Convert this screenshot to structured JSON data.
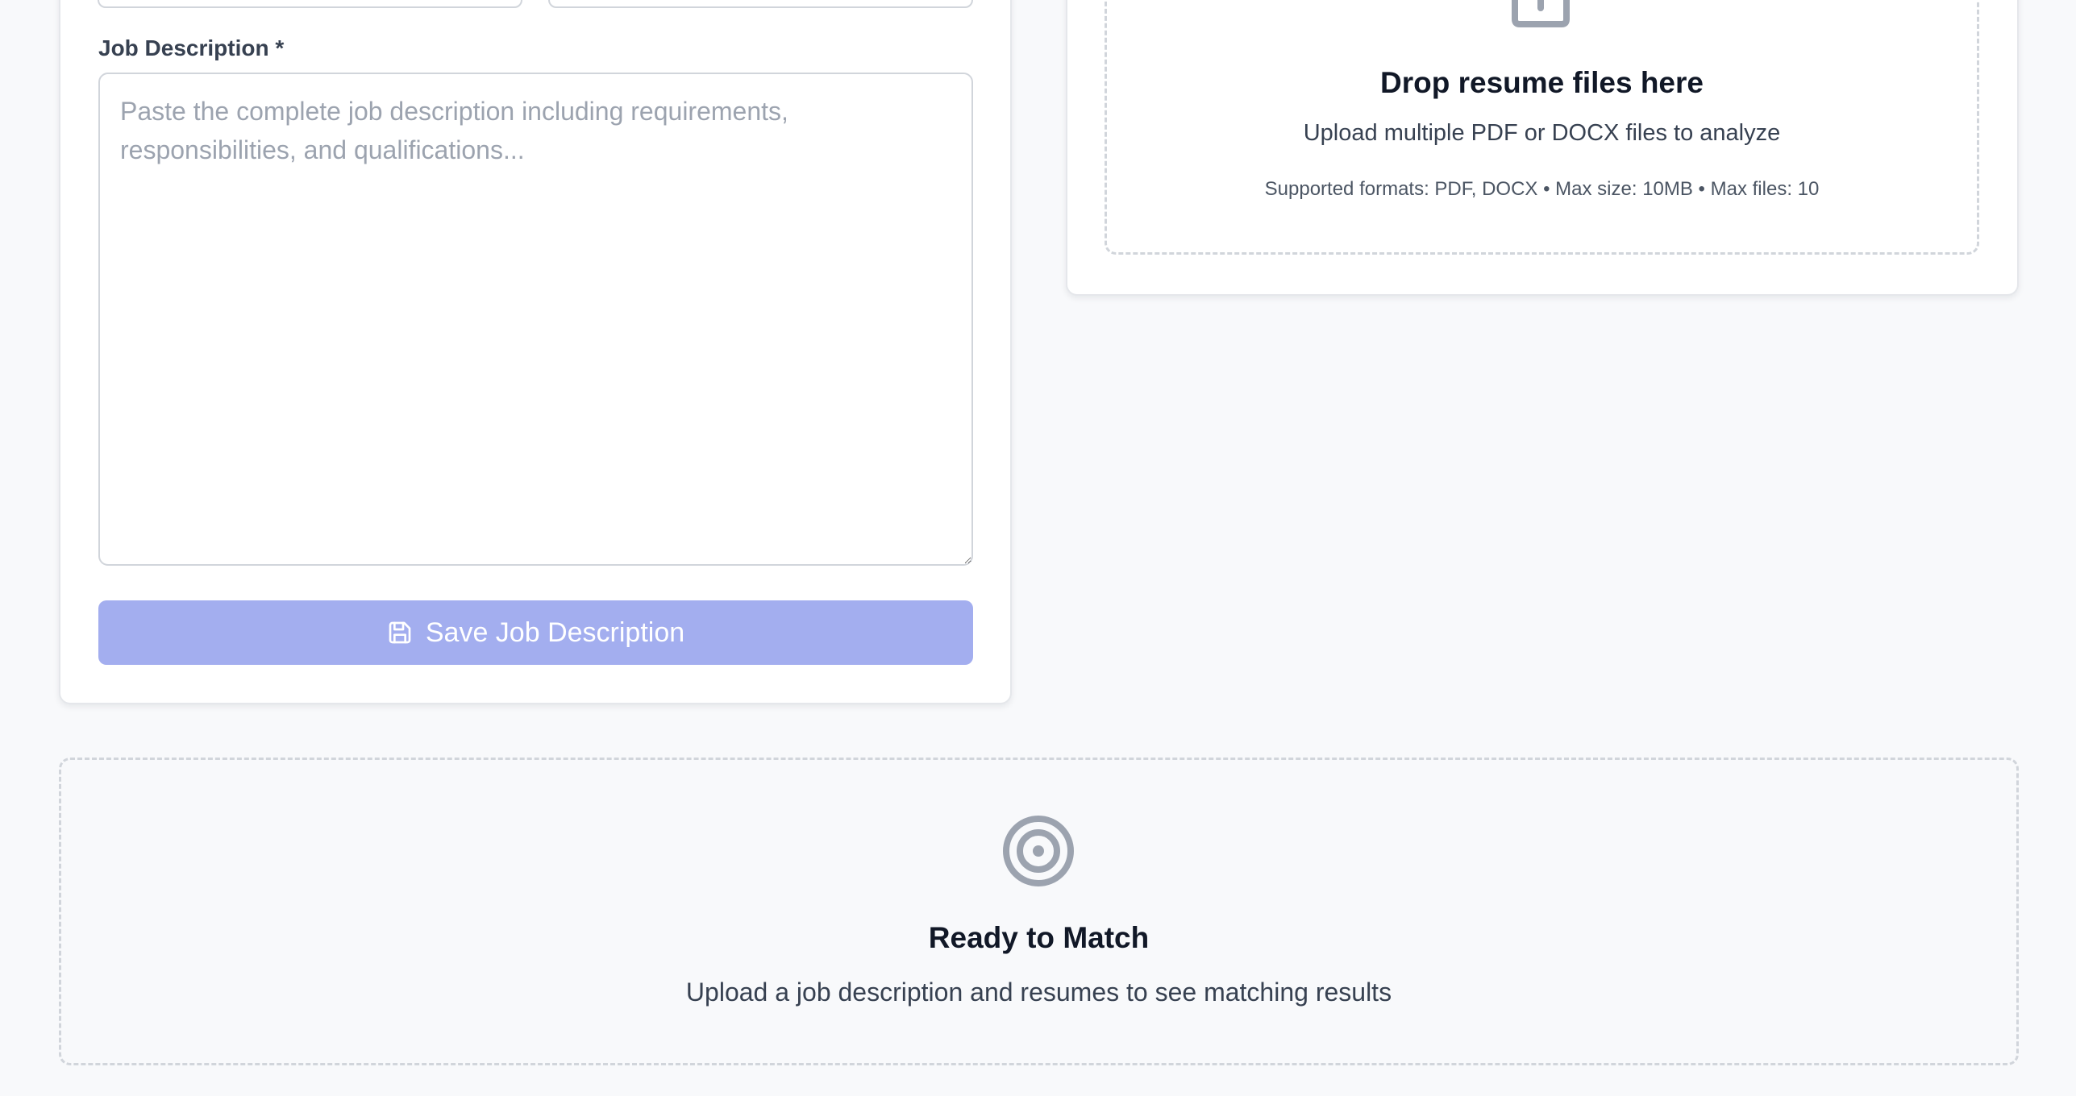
{
  "job_form": {
    "description_label": "Job Description *",
    "description_placeholder": "Paste the complete job description including requirements, responsibilities, and qualifications...",
    "description_value": "",
    "save_button_label": "Save Job Description",
    "save_icon": "save-icon"
  },
  "resume_upload": {
    "icon": "upload-icon",
    "title": "Drop resume files here",
    "subtitle": "Upload multiple PDF or DOCX files to analyze",
    "formats_note": "Supported formats: PDF, DOCX • Max size: 10MB • Max files: 10"
  },
  "results": {
    "icon": "target-icon",
    "title": "Ready to Match",
    "subtitle": "Upload a job description and resumes to see matching results"
  },
  "colors": {
    "primary_button_disabled": "#a3aeef",
    "icon_gray": "#9ca3af",
    "border": "#d1d5db",
    "background": "#f8f9fb"
  }
}
